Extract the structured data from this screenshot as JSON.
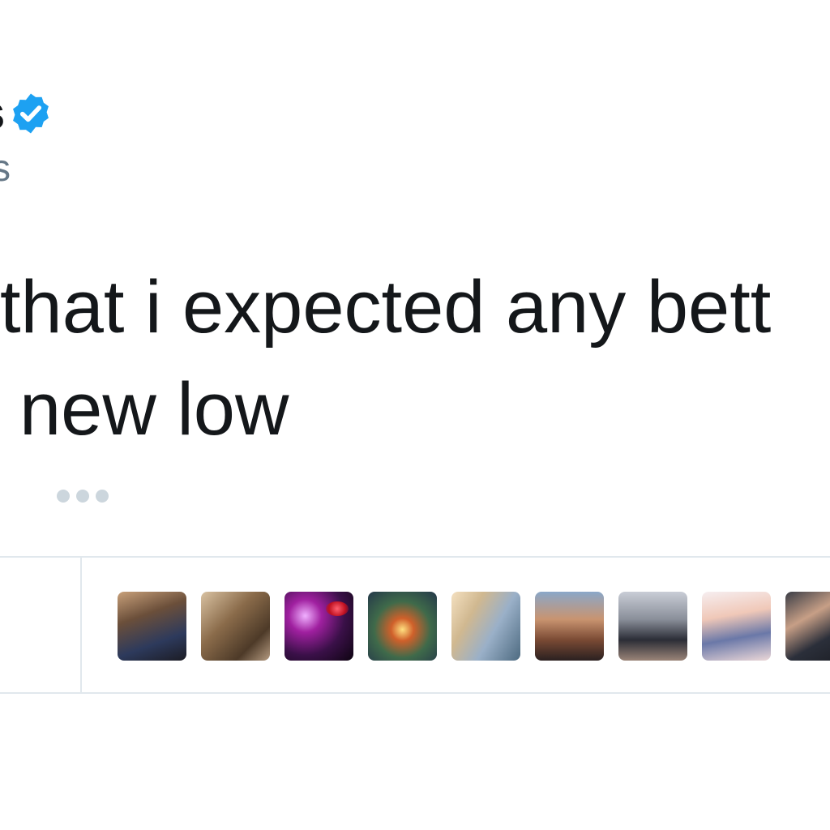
{
  "tweet": {
    "author_name_fragment": "s",
    "author_handle_fragment": "s",
    "verified_icon": "verified-badge-icon",
    "text_lines": [
      "that i expected any bett",
      "new low"
    ]
  },
  "more_menu": {
    "icon": "more-dots-icon"
  },
  "engagement": {
    "avatars": [
      {
        "icon": "user-avatar"
      },
      {
        "icon": "user-avatar"
      },
      {
        "icon": "user-avatar"
      },
      {
        "icon": "user-avatar"
      },
      {
        "icon": "user-avatar"
      },
      {
        "icon": "user-avatar"
      },
      {
        "icon": "user-avatar"
      },
      {
        "icon": "user-avatar"
      },
      {
        "icon": "user-avatar"
      }
    ]
  },
  "colors": {
    "text": "#14171a",
    "secondary_text": "#657786",
    "verified_blue": "#1da1f2",
    "divider": "#e1e8ed",
    "dots": "#ccd6dd"
  }
}
